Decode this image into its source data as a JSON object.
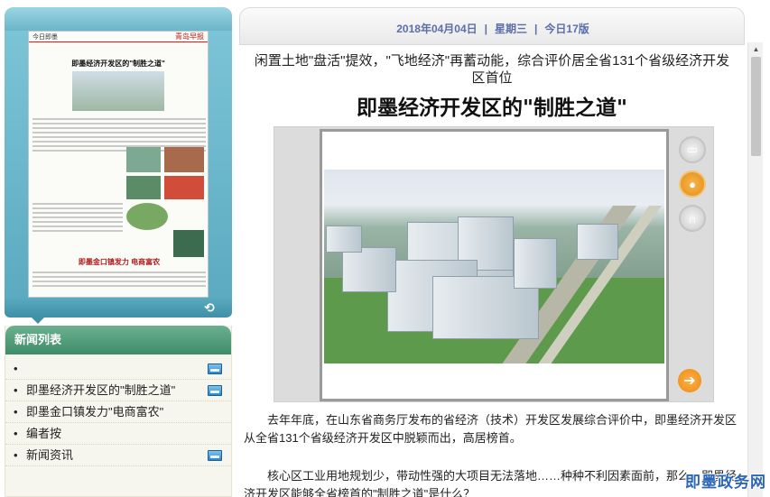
{
  "thumbnail": {
    "page_label": "今日即墨",
    "masthead": "青岛早报",
    "headline": "即墨经济开发区的\"制胜之道\"",
    "footer_headline": "即墨金口镇发力 电商富农"
  },
  "news_list": {
    "title": "新闻列表",
    "items": [
      {
        "label": "",
        "has_image": true
      },
      {
        "label": "即墨经济开发区的\"制胜之道\"",
        "has_image": true
      },
      {
        "label": "即墨金口镇发力\"电商富农\"",
        "has_image": false
      },
      {
        "label": "编者按",
        "has_image": false
      },
      {
        "label": "新闻资讯",
        "has_image": true
      }
    ]
  },
  "header": {
    "date": "2018年04月04日",
    "weekday": "星期三",
    "edition": "今日17版"
  },
  "article": {
    "subtitle": "闲置土地\"盘活\"提效，\"飞地经济\"再蓄动能，综合评价居全省131个省级经济开发区首位",
    "headline": "即墨经济开发区的\"制胜之道\"",
    "paragraphs": [
      "去年年底，在山东省商务厅发布的省经济（技术）开发区发展综合评价中，即墨经济开发区从全省131个省级经济开发区中脱颖而出，高居榜首。",
      "核心区工业用地规划少，带动性强的大项目无法落地……种种不利因素面前，那么，即墨经济开发区能够全省榜首的\"制胜之道\"是什么？"
    ]
  },
  "media_buttons": [
    "video-icon",
    "person-icon",
    "audio-icon"
  ],
  "watermark": "即墨政务网",
  "colors": {
    "date_text": "#5a6ea8",
    "news_header": "#3f8c6a",
    "thumb_frame": "#5aa9bf",
    "active_button": "#e38d12"
  }
}
